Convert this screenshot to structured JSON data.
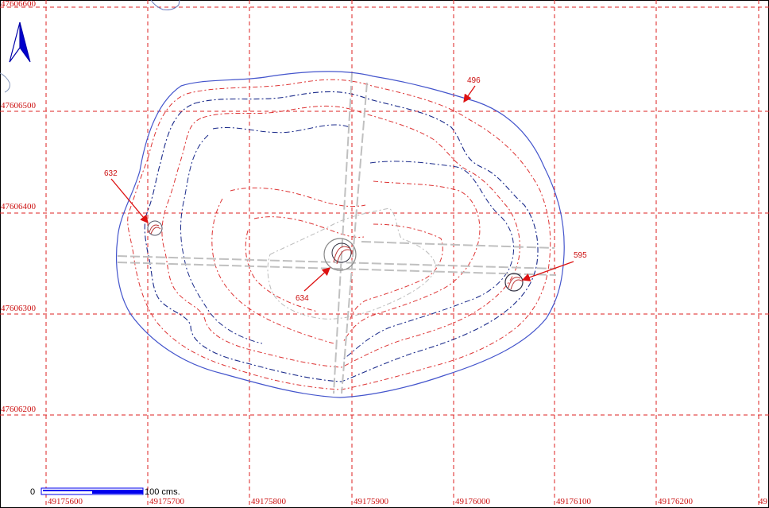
{
  "map": {
    "x_ticks": [
      "49175600",
      "49175700",
      "49175800",
      "49175900",
      "49176000",
      "49176100",
      "49176200",
      "49"
    ],
    "y_ticks": [
      "47606600",
      "47606500",
      "47606400",
      "47606300",
      "47606200"
    ],
    "points": [
      {
        "label": "496"
      },
      {
        "label": "632"
      },
      {
        "label": "634"
      },
      {
        "label": "595"
      }
    ],
    "scale": {
      "start_label": "0",
      "end_label": "100 cms."
    },
    "north_arrow": "north-arrow-icon",
    "colors": {
      "grid": "#dd2222",
      "outer_contour": "#4455cc",
      "blue_contour": "#1a2a8a",
      "red_contour": "#dd3333",
      "gray_lines": "#b8b8b8",
      "arrow": "#dd1111",
      "scale_bar": "#0000ee"
    }
  }
}
